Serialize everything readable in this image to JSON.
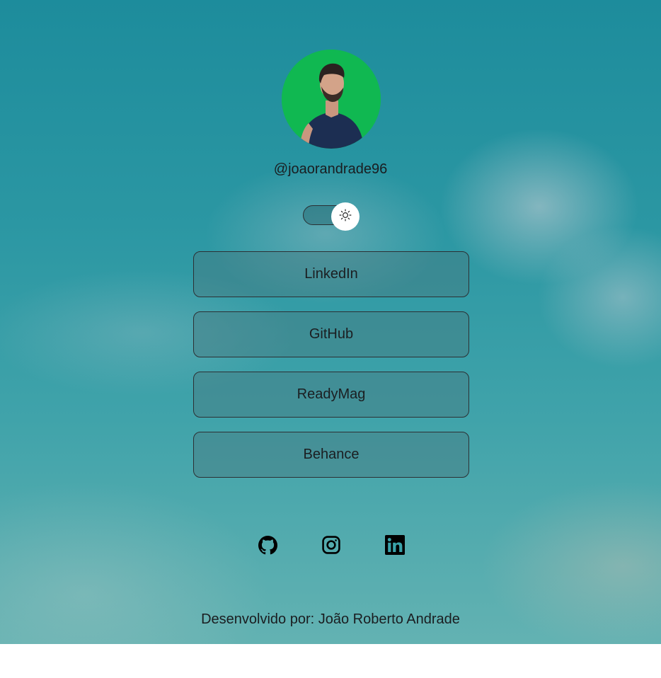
{
  "profile": {
    "handle": "@joaorandrade96"
  },
  "theme_toggle": {
    "icon": "sun-icon"
  },
  "links": [
    {
      "label": "LinkedIn"
    },
    {
      "label": "GitHub"
    },
    {
      "label": "ReadyMag"
    },
    {
      "label": "Behance"
    }
  ],
  "social": [
    {
      "icon": "github-icon"
    },
    {
      "icon": "instagram-icon"
    },
    {
      "icon": "linkedin-icon"
    }
  ],
  "footer": {
    "text": "Desenvolvido por: João Roberto Andrade"
  },
  "colors": {
    "background": "#2b97a3",
    "avatar_bg": "#10b851",
    "text": "#1a1d20"
  }
}
